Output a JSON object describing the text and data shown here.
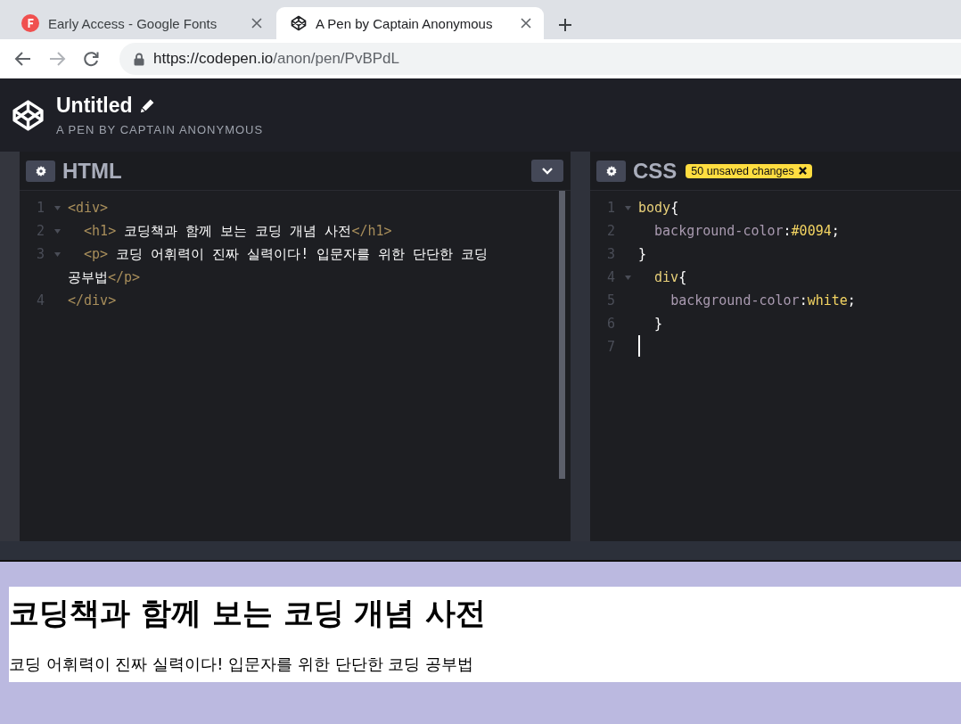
{
  "browser": {
    "tabs": [
      {
        "title": "Early Access - Google Fonts",
        "kind": "fonts",
        "selected": false
      },
      {
        "title": "A Pen by Captain Anonymous",
        "kind": "codepen",
        "selected": true
      }
    ],
    "url": {
      "host": "https://codepen.io",
      "path": "/anon/pen/PvBPdL"
    }
  },
  "pen": {
    "title": "Untitled",
    "subtitle": "A PEN BY CAPTAIN ANONYMOUS"
  },
  "editors": [
    {
      "kind": "html",
      "title": "HTML",
      "lines": [
        {
          "number": "1",
          "foldable": true,
          "cursor": false,
          "tokens": [
            {
              "kind": "tag",
              "text": "<div>"
            }
          ]
        },
        {
          "number": "2",
          "foldable": true,
          "cursor": false,
          "tokens": [
            {
              "kind": "tag",
              "text": "  <h1>"
            },
            {
              "kind": "text",
              "text": " 코딩책과 함께 보는 코딩 개념 사전"
            },
            {
              "kind": "tag",
              "text": "</h1>"
            }
          ]
        },
        {
          "number": "3",
          "foldable": true,
          "cursor": false,
          "tokens": [
            {
              "kind": "tag",
              "text": "  <p>"
            },
            {
              "kind": "text",
              "text": " 코딩 어휘력이 진짜 실력이다! 입문자를 위한 단단한 코딩 공부법"
            },
            {
              "kind": "tag",
              "text": "</p>"
            }
          ]
        },
        {
          "number": "4",
          "foldable": false,
          "cursor": false,
          "tokens": [
            {
              "kind": "tag",
              "text": "</div>"
            }
          ]
        }
      ]
    },
    {
      "kind": "css",
      "title": "CSS",
      "badge": "50 unsaved changes",
      "lines": [
        {
          "number": "1",
          "foldable": true,
          "cursor": false,
          "tokens": [
            {
              "kind": "selector",
              "text": "body"
            },
            {
              "kind": "punct",
              "text": "{"
            }
          ]
        },
        {
          "number": "2",
          "foldable": false,
          "cursor": false,
          "tokens": [
            {
              "kind": "property",
              "text": "  background-color"
            },
            {
              "kind": "punct",
              "text": ":"
            },
            {
              "kind": "value",
              "text": "#0094"
            },
            {
              "kind": "punct",
              "text": ";"
            }
          ]
        },
        {
          "number": "3",
          "foldable": false,
          "cursor": false,
          "tokens": [
            {
              "kind": "punct",
              "text": "}"
            }
          ]
        },
        {
          "number": "4",
          "foldable": true,
          "cursor": false,
          "tokens": [
            {
              "kind": "selector",
              "text": "  div"
            },
            {
              "kind": "punct",
              "text": "{"
            }
          ]
        },
        {
          "number": "5",
          "foldable": false,
          "cursor": false,
          "tokens": [
            {
              "kind": "property",
              "text": "    background-color"
            },
            {
              "kind": "punct",
              "text": ":"
            },
            {
              "kind": "value",
              "text": "white"
            },
            {
              "kind": "punct",
              "text": ";"
            }
          ]
        },
        {
          "number": "6",
          "foldable": false,
          "cursor": false,
          "tokens": [
            {
              "kind": "punct",
              "text": "  }"
            }
          ]
        },
        {
          "number": "7",
          "foldable": false,
          "cursor": true
        }
      ]
    }
  ],
  "preview": {
    "heading": "코딩책과 함께 보는 코딩 개념 사전",
    "paragraph": "코딩 어휘력이 진짜 실력이다! 입문자를 위한 단단한 코딩 공부법"
  }
}
